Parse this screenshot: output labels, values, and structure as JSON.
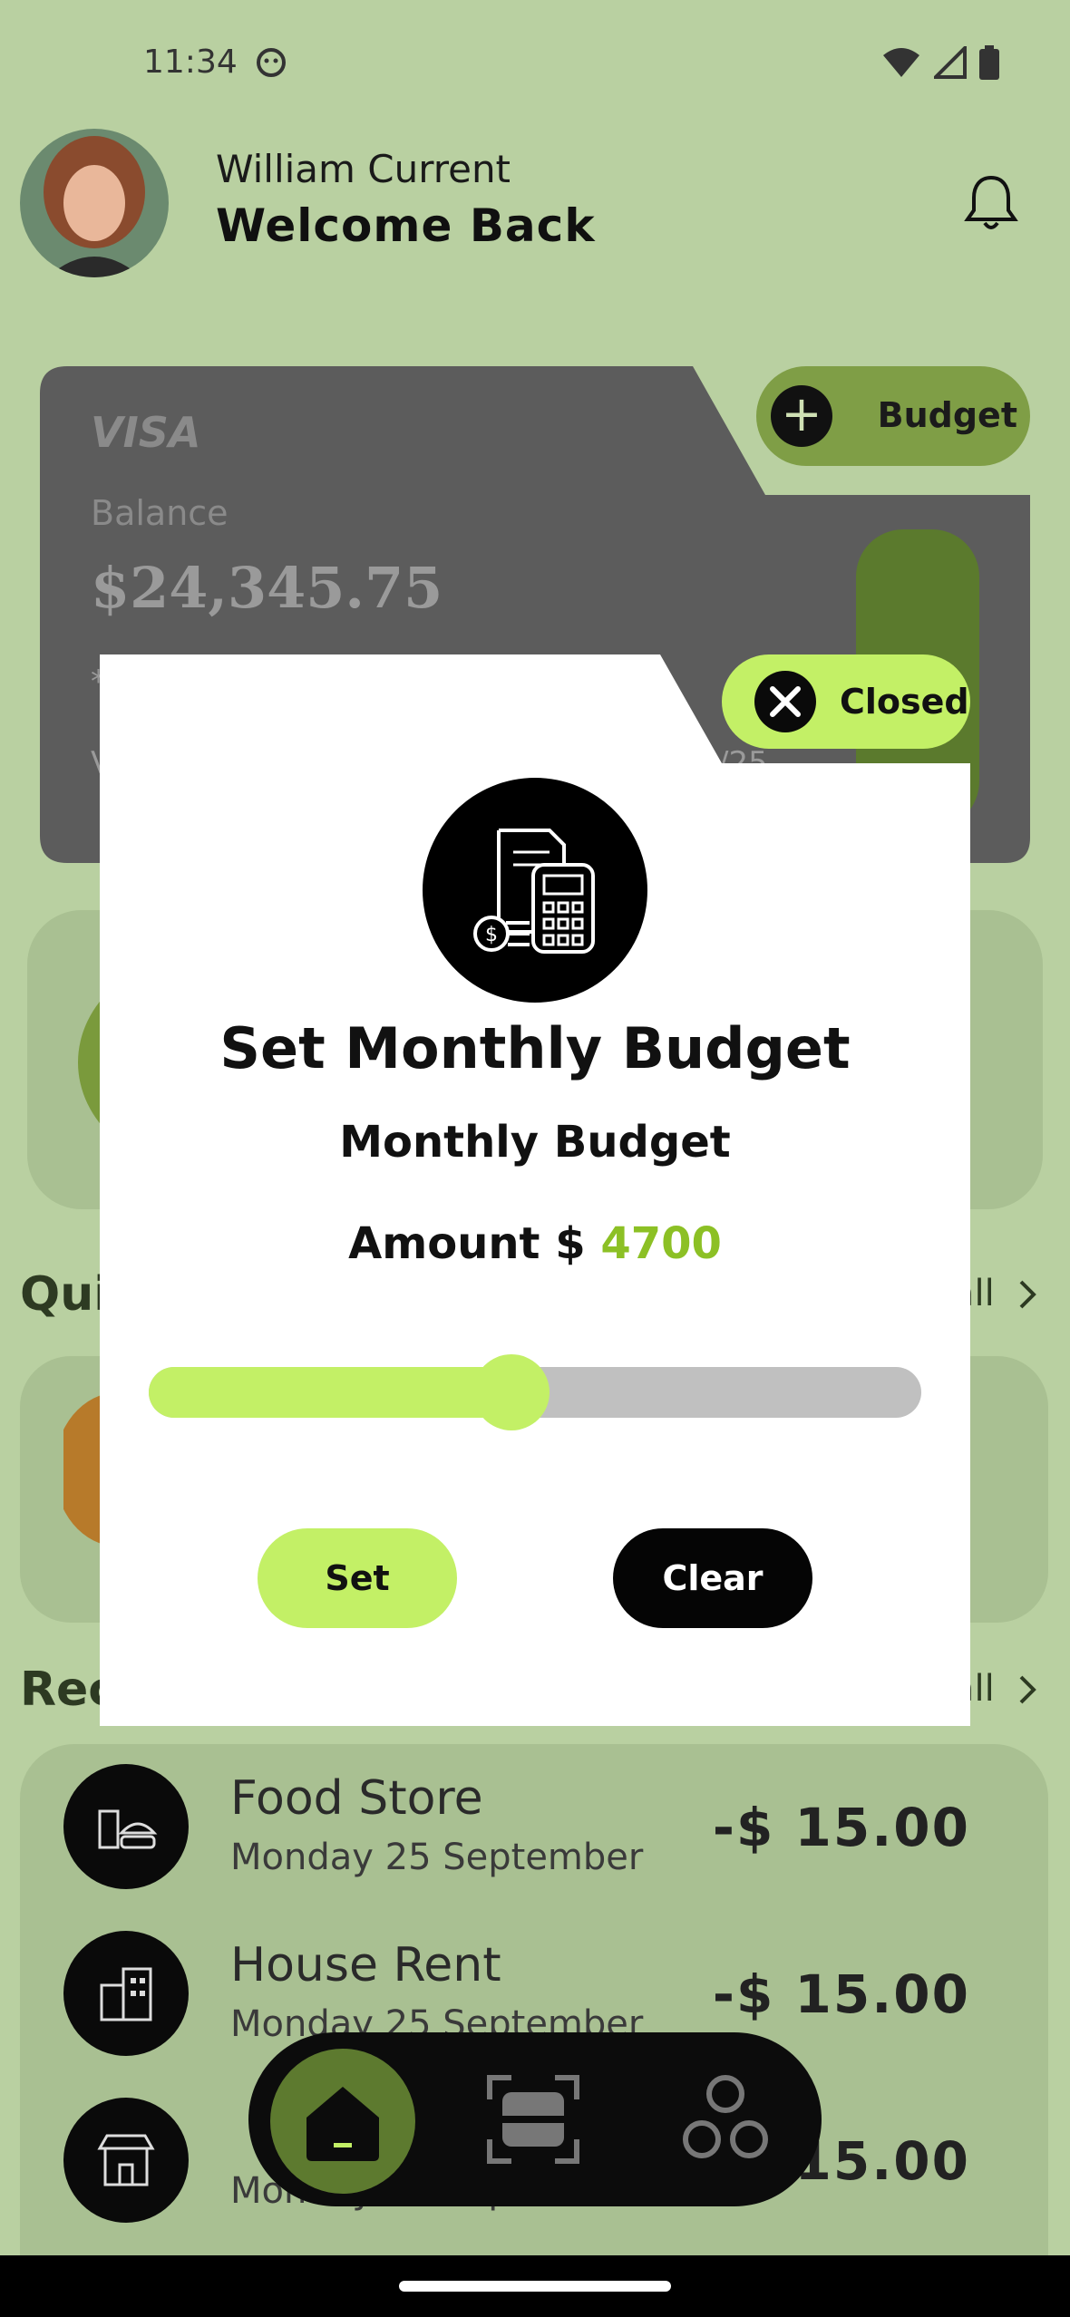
{
  "status_bar": {
    "time": "11:34"
  },
  "header": {
    "user_name": "William Current",
    "greeting": "Welcome Back"
  },
  "card": {
    "brand": "VISA",
    "balance_label": "Balance",
    "balance_value": "$24,345.75",
    "masked_number": "*",
    "holder_initial": "V",
    "expiry_partial": "/25",
    "budget_button_label": "Budget"
  },
  "sections": {
    "quick_title_partial": "Qui",
    "recent_title_partial": "Rec",
    "see_all_partial": "all"
  },
  "transactions": [
    {
      "title": "Food Store",
      "date": "Monday 25 September",
      "amount": "-$ 15.00",
      "icon": "food-store-icon"
    },
    {
      "title": "House Rent",
      "date": "Monday 25 September",
      "amount": "-$ 15.00",
      "icon": "building-icon"
    },
    {
      "title": "",
      "date": "Monday 25 September",
      "amount": "15.00",
      "icon": "shop-icon"
    }
  ],
  "modal": {
    "close_label": "Closed",
    "title": "Set Monthly Budget",
    "subtitle": "Monthly Budget",
    "amount_prefix": "Amount $",
    "amount_value": "4700",
    "slider_fraction": 0.47,
    "set_label": "Set",
    "clear_label": "Clear"
  },
  "colors": {
    "accent": "#c3f066",
    "backdrop": "#b9d0a1",
    "amount_green": "#8cc025",
    "dark": "#0a0a0a"
  }
}
